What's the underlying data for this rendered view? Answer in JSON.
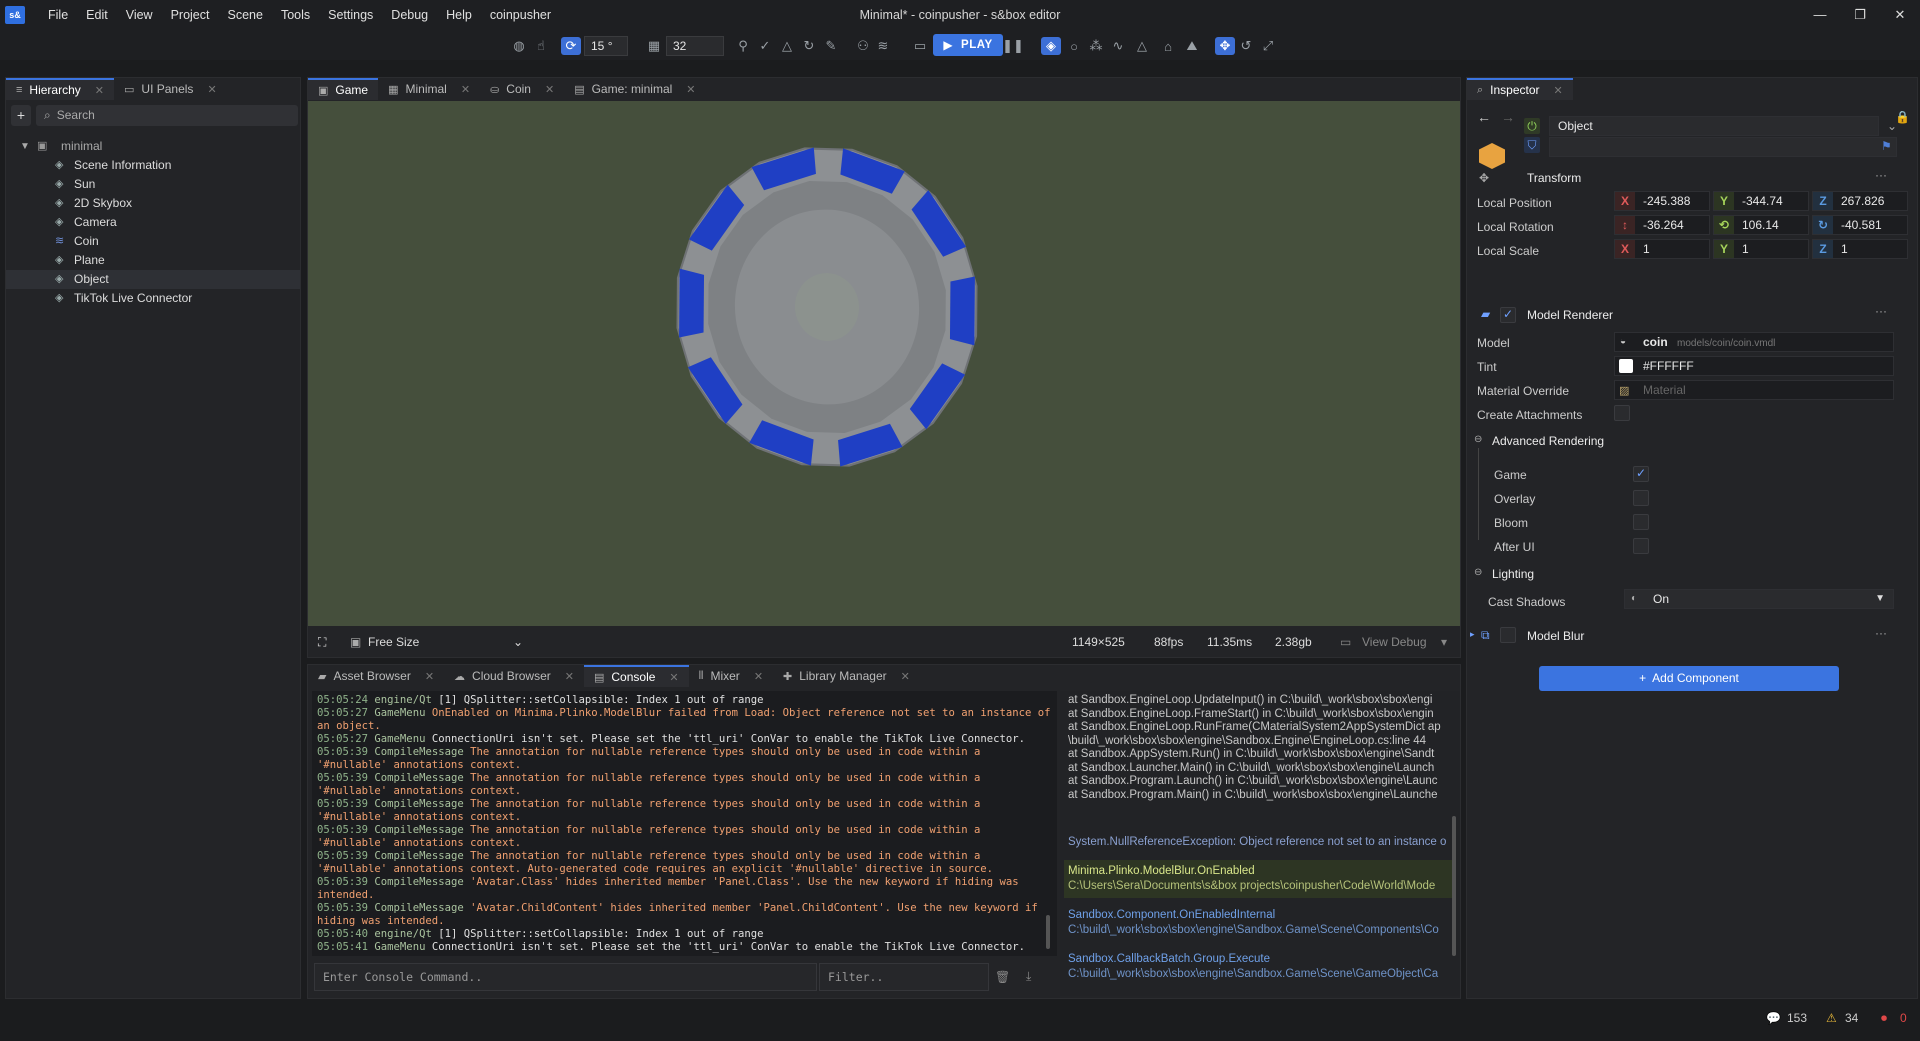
{
  "app": {
    "logo": "s&",
    "title": "Minimal* - coinpusher - s&box editor",
    "menu": [
      "File",
      "Edit",
      "View",
      "Project",
      "Scene",
      "Tools",
      "Settings",
      "Debug",
      "Help",
      "coinpusher"
    ]
  },
  "toolbar": {
    "angle_snap": "15",
    "angle_unit": "°",
    "grid_size": "32",
    "play_label": "PLAY"
  },
  "hierarchy": {
    "tabs": [
      "Hierarchy",
      "UI Panels"
    ],
    "search_placeholder": "Search",
    "add_label": "+",
    "root": "minimal",
    "items": [
      "Scene Information",
      "Sun",
      "2D Skybox",
      "Camera",
      "Coin",
      "Plane",
      "Object",
      "TikTok Live Connector"
    ],
    "selected_index": 6
  },
  "viewport": {
    "tabs": [
      "Game",
      "Minimal",
      "Coin",
      "Game: minimal"
    ],
    "size_mode": "Free Size",
    "resolution": "1149×525",
    "fps": "88fps",
    "frame_time": "11.35ms",
    "memory": "2.38gb",
    "view_debug": "View Debug",
    "coin_segments": 10
  },
  "dock": {
    "tabs": [
      "Asset Browser",
      "Cloud Browser",
      "Console",
      "Mixer",
      "Library Manager"
    ],
    "active_tab": "Console",
    "command_placeholder": "Enter Console Command..",
    "filter_placeholder": "Filter..",
    "log": [
      {
        "time": "05:05:24",
        "src": "engine/Qt",
        "level": "info",
        "msg": "[1] QSplitter::setCollapsible: Index 1 out of range"
      },
      {
        "time": "05:05:27",
        "src": "GameMenu",
        "level": "err",
        "msg": "OnEnabled on Minima.Plinko.ModelBlur failed from Load: Object reference not set to an instance of an object."
      },
      {
        "time": "05:05:27",
        "src": "GameMenu",
        "level": "info",
        "msg": "ConnectionUri isn't set. Please set the 'ttl_uri' ConVar to enable the TikTok Live Connector."
      },
      {
        "time": "05:05:39",
        "src": "CompileMessage",
        "level": "err",
        "msg": "The annotation for nullable reference types should only be used in code within a '#nullable' annotations context."
      },
      {
        "time": "05:05:39",
        "src": "CompileMessage",
        "level": "err",
        "msg": "The annotation for nullable reference types should only be used in code within a '#nullable' annotations context."
      },
      {
        "time": "05:05:39",
        "src": "CompileMessage",
        "level": "err",
        "msg": "The annotation for nullable reference types should only be used in code within a '#nullable' annotations context."
      },
      {
        "time": "05:05:39",
        "src": "CompileMessage",
        "level": "err",
        "msg": "The annotation for nullable reference types should only be used in code within a '#nullable' annotations context."
      },
      {
        "time": "05:05:39",
        "src": "CompileMessage",
        "level": "err",
        "msg": "The annotation for nullable reference types should only be used in code within a '#nullable' annotations context. Auto-generated code requires an explicit '#nullable' directive in source."
      },
      {
        "time": "05:05:39",
        "src": "CompileMessage",
        "level": "err",
        "msg": "'Avatar.Class' hides inherited member 'Panel.Class'. Use the new keyword if hiding was intended."
      },
      {
        "time": "05:05:39",
        "src": "CompileMessage",
        "level": "err",
        "msg": "'Avatar.ChildContent' hides inherited member 'Panel.ChildContent'. Use the new keyword if hiding was intended."
      },
      {
        "time": "05:05:40",
        "src": "engine/Qt",
        "level": "info",
        "msg": "[1] QSplitter::setCollapsible: Index 1 out of range"
      },
      {
        "time": "05:05:41",
        "src": "GameMenu",
        "level": "info",
        "msg": "ConnectionUri isn't set. Please set the 'ttl_uri' ConVar to enable the TikTok Live Connector."
      }
    ],
    "stack_text": [
      "   at Sandbox.EngineLoop.UpdateInput() in C:\\build\\_work\\sbox\\sbox\\engi",
      "   at Sandbox.EngineLoop.FrameStart() in C:\\build\\_work\\sbox\\sbox\\engin",
      "   at Sandbox.EngineLoop.RunFrame(CMaterialSystem2AppSystemDict ap",
      "\\build\\_work\\sbox\\sbox\\engine\\Sandbox.Engine\\EngineLoop.cs:line 44",
      "   at Sandbox.AppSystem.Run() in C:\\build\\_work\\sbox\\sbox\\engine\\Sandt",
      "   at Sandbox.Launcher.Main() in C:\\build\\_work\\sbox\\sbox\\engine\\Launch",
      "   at Sandbox.Program.Launch() in C:\\build\\_work\\sbox\\sbox\\engine\\Launc",
      "   at Sandbox.Program.Main() in C:\\build\\_work\\sbox\\sbox\\engine\\Launche"
    ],
    "exception": "System.NullReferenceException: Object reference not set to an instance o",
    "frames": [
      {
        "fn": "Minima.Plinko.ModelBlur.OnEnabled",
        "path": "C:\\Users\\Sera\\Documents\\s&box projects\\coinpusher\\Code\\World\\Mode"
      },
      {
        "fn": "Sandbox.Component.OnEnabledInternal",
        "path": "C:\\build\\_work\\sbox\\sbox\\engine\\Sandbox.Game\\Scene\\Components\\Co"
      },
      {
        "fn": "Sandbox.CallbackBatch.Group.Execute",
        "path": "C:\\build\\_work\\sbox\\sbox\\engine\\Sandbox.Game\\Scene\\GameObject\\Ca"
      }
    ]
  },
  "inspector": {
    "tab": "Inspector",
    "object_name": "Object",
    "transform_label": "Transform",
    "position_label": "Local Position",
    "rotation_label": "Local Rotation",
    "scale_label": "Local Scale",
    "position": {
      "x": "-245.388",
      "y": "-344.74",
      "z": "267.826"
    },
    "rotation": {
      "p": "-36.264",
      "y": "106.14",
      "r": "-40.581"
    },
    "scale": {
      "x": "1",
      "y": "1",
      "z": "1"
    },
    "axis_labels": {
      "x": "X",
      "y": "Y",
      "z": "Z"
    },
    "model_renderer": "Model Renderer",
    "model_label": "Model",
    "model_name": "coin",
    "model_path": "models/coin/coin.vmdl",
    "tint_label": "Tint",
    "tint_value": "#FFFFFF",
    "material_label": "Material Override",
    "material_placeholder": "Material",
    "attachments_label": "Create Attachments",
    "advanced_label": "Advanced Rendering",
    "adv_items": [
      {
        "label": "Game",
        "checked": true
      },
      {
        "label": "Overlay",
        "checked": false
      },
      {
        "label": "Bloom",
        "checked": false
      },
      {
        "label": "After UI",
        "checked": false
      }
    ],
    "lighting_label": "Lighting",
    "shadows_label": "Cast Shadows",
    "shadows_value": "On",
    "model_blur": "Model Blur",
    "add_component": "Add Component"
  },
  "status": {
    "messages": "153",
    "warnings": "34",
    "errors": "0"
  },
  "colors": {
    "accent": "#3b74e0",
    "viewport_bg": "#454f3c",
    "coin_face": "#8c8f92",
    "coin_stripe": "#1f3fc4"
  }
}
